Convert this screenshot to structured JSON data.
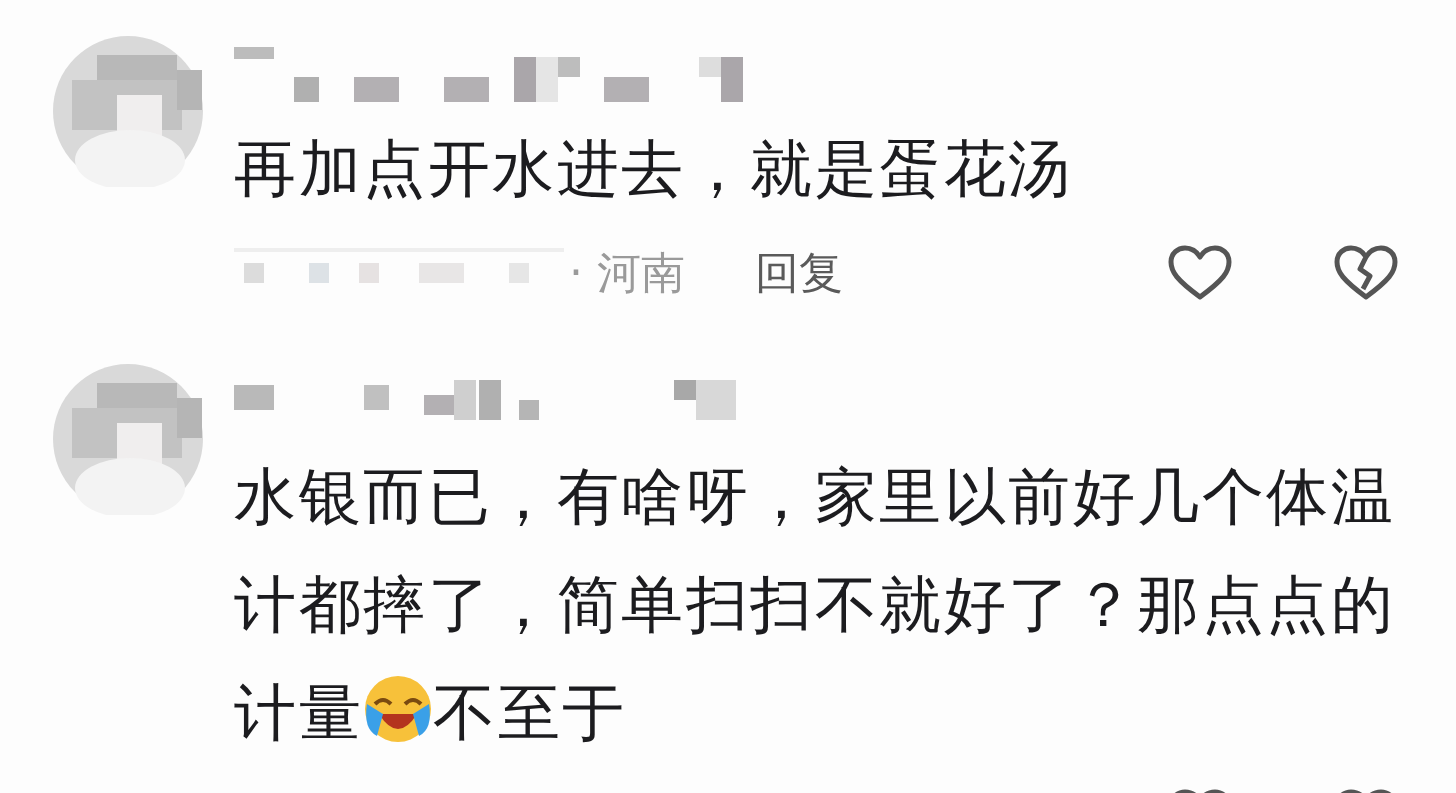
{
  "comments": [
    {
      "body": [
        {
          "kind": "text",
          "text": "再加点开水进去，就是蛋花汤"
        }
      ],
      "location": "· 河南",
      "reply": "回复"
    },
    {
      "body": [
        {
          "kind": "text",
          "text": "水银而已，有啥呀，家里以前好几个体温计都摔了，简单扫扫不就好了？那点点的"
        },
        {
          "kind": "break"
        },
        {
          "kind": "text",
          "text": "计量"
        },
        {
          "kind": "emoji"
        },
        {
          "kind": "text",
          "text": "不至于"
        }
      ]
    }
  ]
}
